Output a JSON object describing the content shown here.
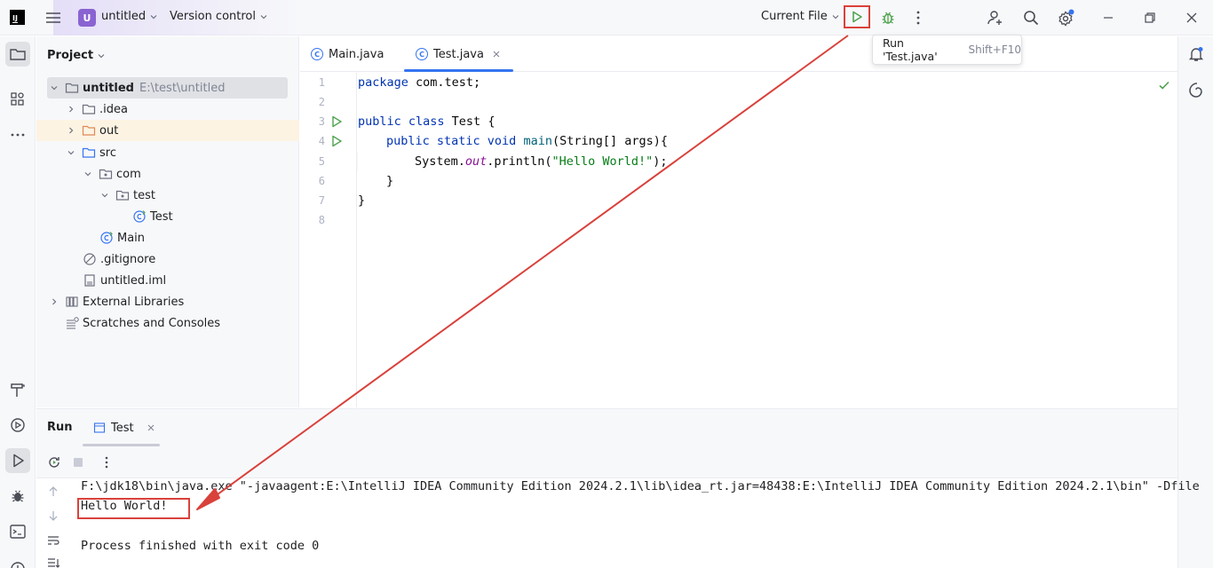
{
  "titlebar": {
    "app_logo": "IJ",
    "project_initial": "U",
    "project_name": "untitled",
    "vcs_label": "Version control",
    "run_config": "Current File"
  },
  "tooltip": {
    "label": "Run 'Test.java'",
    "shortcut": "Shift+F10"
  },
  "project_panel": {
    "title": "Project",
    "tree": [
      {
        "label": "untitled",
        "sub": "E:\\test\\untitled"
      },
      {
        "label": ".idea"
      },
      {
        "label": "out"
      },
      {
        "label": "src"
      },
      {
        "label": "com"
      },
      {
        "label": "test"
      },
      {
        "label": "Test"
      },
      {
        "label": "Main"
      },
      {
        "label": ".gitignore"
      },
      {
        "label": "untitled.iml"
      },
      {
        "label": "External Libraries"
      },
      {
        "label": "Scratches and Consoles"
      }
    ]
  },
  "editor": {
    "tabs": [
      {
        "label": "Main.java"
      },
      {
        "label": "Test.java"
      }
    ],
    "line_numbers": [
      "1",
      "2",
      "3",
      "4",
      "5",
      "6",
      "7",
      "8"
    ],
    "code": {
      "l1_kw": "package",
      "l1_rest": " com.test;",
      "l3_kw": "public class",
      "l3_rest": " Test {",
      "l4_kw": "public static void",
      "l4_fn": "main",
      "l4_rest": "(String[] args){",
      "l5_a": "System.",
      "l5_fld": "out",
      "l5_b": ".println(",
      "l5_str": "\"Hello World!\"",
      "l5_c": ");",
      "l6": "}",
      "l7": "}"
    }
  },
  "run_panel": {
    "title": "Run",
    "tab": "Test",
    "command": "F:\\jdk18\\bin\\java.exe \"-javaagent:E:\\IntelliJ IDEA Community Edition 2024.2.1\\lib\\idea_rt.jar=48438:E:\\IntelliJ IDEA Community Edition 2024.2.1\\bin\" -Dfile",
    "output": "Hello World!",
    "exit": "Process finished with exit code 0"
  },
  "colors": {
    "accent": "#3574f0",
    "run_green": "#4fa34f",
    "annotation_red": "#d9413b",
    "project_badge": "#8a63d2",
    "selected_row": "#dfe1e5",
    "out_row": "#fdf3e3"
  }
}
